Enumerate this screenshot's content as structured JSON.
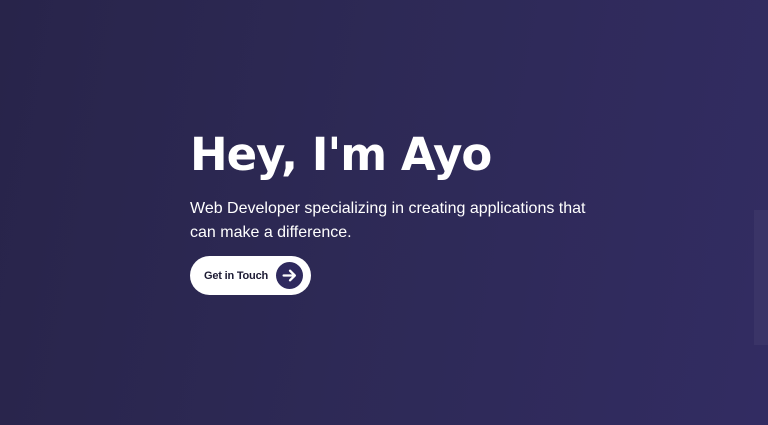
{
  "hero": {
    "title": "Hey, I'm Ayo",
    "subtitle": "Web Developer specializing in creating applications that can make a difference.",
    "cta_label": "Get in Touch",
    "cta_icon": "arrow-right-icon"
  },
  "colors": {
    "background": "#2d2955",
    "accent": "#2f2a5e",
    "text": "#ffffff"
  }
}
